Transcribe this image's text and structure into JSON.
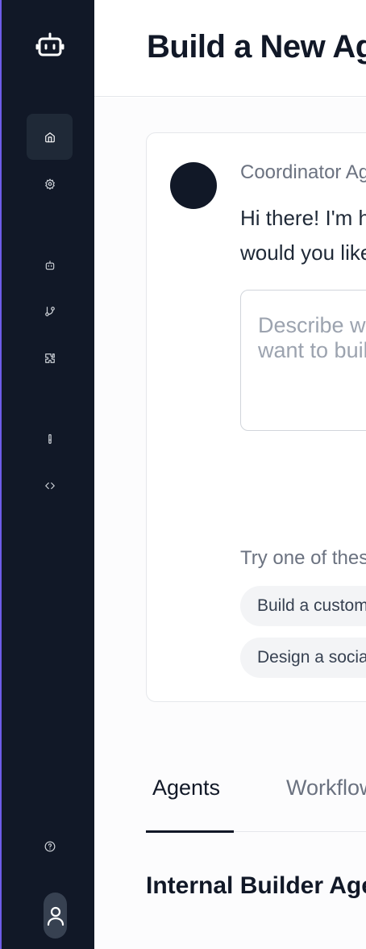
{
  "header": {
    "title": "Build a New Agent"
  },
  "sidebar": {
    "items": [
      {
        "icon": "home-icon",
        "active": true
      },
      {
        "icon": "gear-icon",
        "active": false
      },
      {
        "icon": "bot-icon",
        "active": false
      },
      {
        "icon": "git-branch-icon",
        "active": false
      },
      {
        "icon": "puzzle-icon",
        "active": false
      },
      {
        "icon": "flask-icon",
        "active": false
      },
      {
        "icon": "code-icon",
        "active": false
      },
      {
        "icon": "help-circle-icon",
        "active": false
      }
    ],
    "user_icon": "user-icon"
  },
  "coordinator": {
    "name": "Coordinator Agent",
    "greeting": "Hi there! I'm here to help. What would you like to create today?",
    "input_placeholder": "Describe what you want to build..."
  },
  "suggestions": {
    "label": "Try one of these:",
    "chips": [
      "Build a custom agent",
      "Design a social media agent"
    ]
  },
  "tabs": [
    {
      "label": "Agents",
      "active": true
    },
    {
      "label": "Workflows",
      "active": false
    }
  ],
  "section": {
    "title": "Internal Builder Agents"
  },
  "colors": {
    "sidebar_bg": "#111827",
    "accent": "#6d5ce8",
    "text_dark": "#111827",
    "text_muted": "#6b7280"
  }
}
